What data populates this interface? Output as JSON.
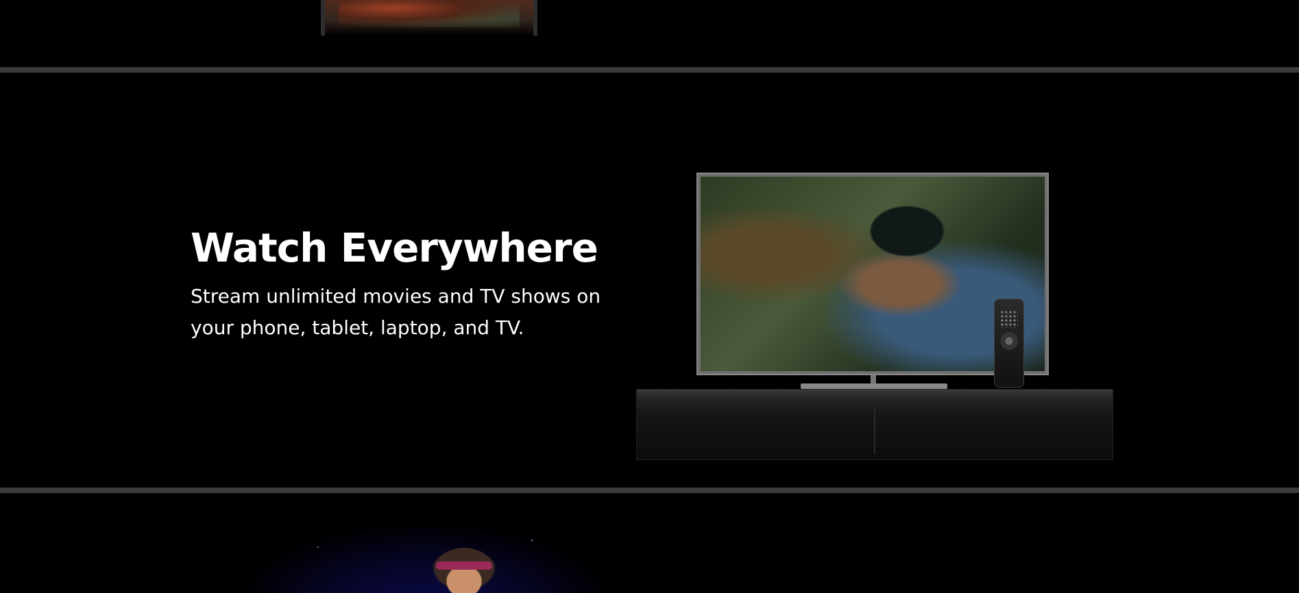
{
  "feature": {
    "title": "Watch Everywhere",
    "description": "Stream unlimited movies and TV shows on your phone, tablet, laptop, and TV."
  },
  "colors": {
    "background": "#000000",
    "divider": "#3b3b3b",
    "text": "#ffffff"
  },
  "images": {
    "top": "device-image-partial",
    "tv": "tv-with-remote-image",
    "bottom": "kids-profile-image-partial"
  }
}
